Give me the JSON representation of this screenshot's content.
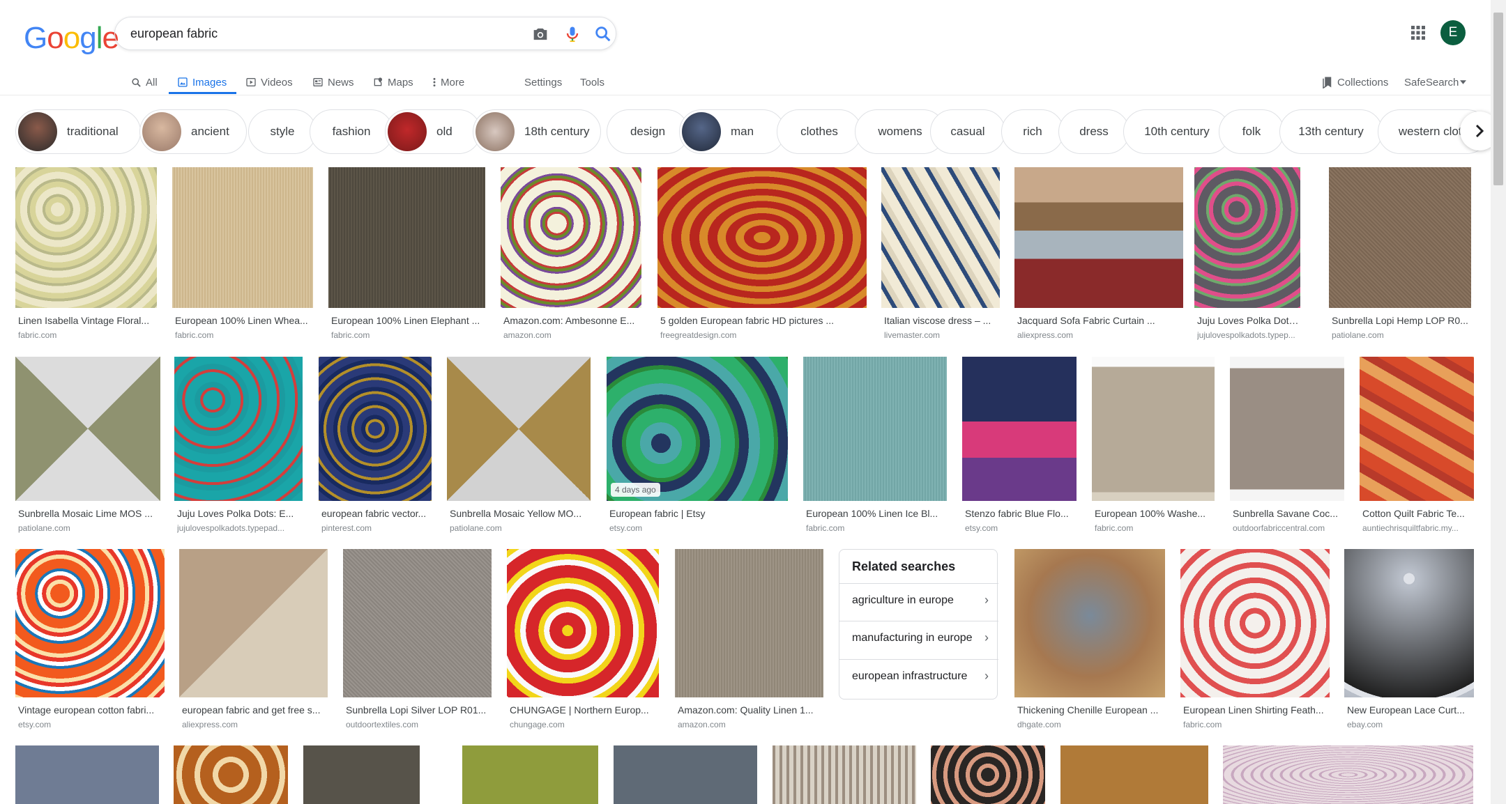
{
  "logo": [
    "G",
    "o",
    "o",
    "g",
    "l",
    "e"
  ],
  "search": {
    "query": "european fabric"
  },
  "account": {
    "initial": "E"
  },
  "nav": {
    "all": "All",
    "images": "Images",
    "videos": "Videos",
    "news": "News",
    "maps": "Maps",
    "more": "More",
    "settings": "Settings",
    "tools": "Tools",
    "collections": "Collections",
    "safesearch": "SafeSearch"
  },
  "chips": [
    "traditional",
    "ancient",
    "style",
    "fashion",
    "old",
    "18th century",
    "design",
    "man",
    "clothes",
    "womens",
    "casual",
    "rich",
    "dress",
    "10th century",
    "folk",
    "13th century",
    "western cloth"
  ],
  "results": [
    {
      "title": "Linen Isabella Vintage Floral...",
      "src": "fabric.com"
    },
    {
      "title": "European 100% Linen Whea...",
      "src": "fabric.com"
    },
    {
      "title": "European 100% Linen Elephant ...",
      "src": "fabric.com"
    },
    {
      "title": "Amazon.com: Ambesonne E...",
      "src": "amazon.com"
    },
    {
      "title": "5 golden European fabric HD pictures ...",
      "src": "freegreatdesign.com"
    },
    {
      "title": "Italian viscose dress – ...",
      "src": "livemaster.com"
    },
    {
      "title": "Jacquard Sofa Fabric Curtain ...",
      "src": "aliexpress.com"
    },
    {
      "title": "Juju Loves Polka Dots...",
      "src": "jujulovespolkadots.typep..."
    },
    {
      "title": "Sunbrella Lopi Hemp LOP R0...",
      "src": "patiolane.com"
    },
    {
      "title": "Sunbrella Mosaic Lime MOS ...",
      "src": "patiolane.com"
    },
    {
      "title": "Juju Loves Polka Dots: E...",
      "src": "jujulovespolkadots.typepad..."
    },
    {
      "title": "european fabric vector...",
      "src": "pinterest.com"
    },
    {
      "title": "Sunbrella Mosaic Yellow MO...",
      "src": "patiolane.com"
    },
    {
      "title": "European fabric | Etsy",
      "src": "etsy.com",
      "badge": "4 days ago"
    },
    {
      "title": "European 100% Linen Ice Bl...",
      "src": "fabric.com"
    },
    {
      "title": "Stenzo fabric Blue Flo...",
      "src": "etsy.com"
    },
    {
      "title": "European 100% Washe...",
      "src": "fabric.com"
    },
    {
      "title": "Sunbrella Savane Coc...",
      "src": "outdoorfabriccentral.com"
    },
    {
      "title": "Cotton Quilt Fabric Te...",
      "src": "auntiechrisquiltfabric.my..."
    },
    {
      "title": "Vintage european cotton fabri...",
      "src": "etsy.com"
    },
    {
      "title": "european fabric and get free s...",
      "src": "aliexpress.com"
    },
    {
      "title": "Sunbrella Lopi Silver LOP R01...",
      "src": "outdoortextiles.com"
    },
    {
      "title": "CHUNGAGE | Northern Europ...",
      "src": "chungage.com"
    },
    {
      "title": "Amazon.com: Quality Linen 1...",
      "src": "amazon.com"
    },
    {
      "title": "Thickening Chenille European ...",
      "src": "dhgate.com"
    },
    {
      "title": "European Linen Shirting Feath...",
      "src": "fabric.com"
    },
    {
      "title": "New European Lace Curt...",
      "src": "ebay.com"
    }
  ],
  "related": {
    "title": "Related searches",
    "items": [
      "agriculture in europe",
      "manufacturing in europe",
      "european infrastructure"
    ]
  }
}
